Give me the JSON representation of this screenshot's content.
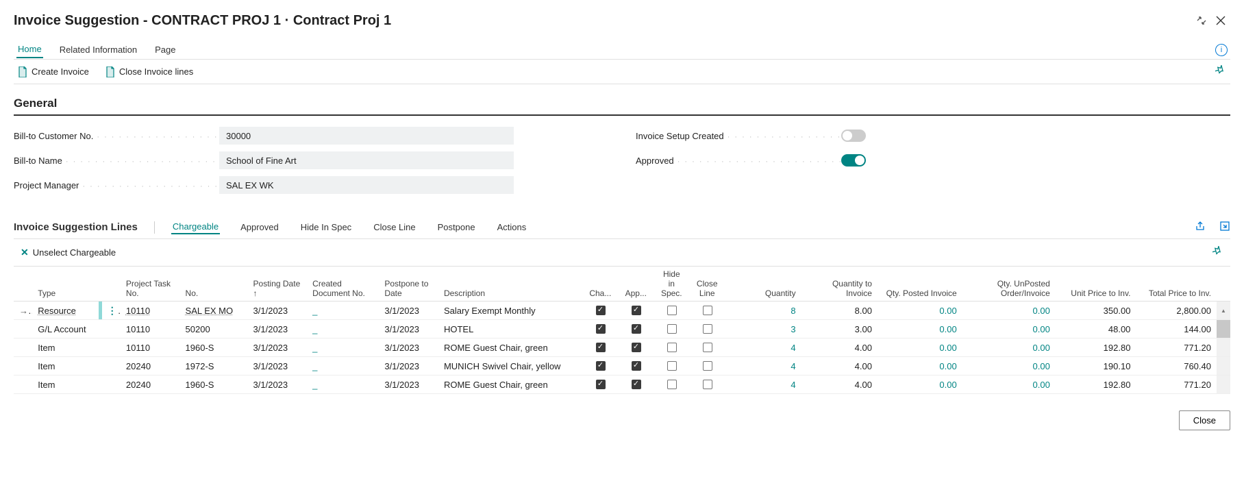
{
  "title": "Invoice Suggestion - CONTRACT PROJ 1 · Contract Proj 1",
  "topTabs": [
    "Home",
    "Related Information",
    "Page"
  ],
  "actions": {
    "createInvoice": "Create Invoice",
    "closeLines": "Close Invoice lines"
  },
  "general": {
    "header": "General",
    "billtoNoLabel": "Bill-to Customer No.",
    "billtoNo": "30000",
    "billtoNameLabel": "Bill-to Name",
    "billtoName": "School of Fine Art",
    "pmLabel": "Project Manager",
    "pm": "SAL EX WK",
    "setupLabel": "Invoice Setup Created",
    "approvedLabel": "Approved"
  },
  "lines": {
    "header": "Invoice Suggestion Lines",
    "tabs": [
      "Chargeable",
      "Approved",
      "Hide In Spec",
      "Close Line",
      "Postpone",
      "Actions"
    ],
    "unselect": "Unselect Chargeable",
    "cols": {
      "type": "Type",
      "taskNo": "Project Task No.",
      "no": "No.",
      "posting": "Posting Date ↑",
      "created": "Created Document No.",
      "postpone": "Postpone to Date",
      "desc": "Description",
      "cha": "Cha...",
      "app": "App...",
      "hide": "Hide in Spec.",
      "close": "Close Line",
      "qty": "Quantity",
      "qtyInv": "Quantity to Invoice",
      "qtyPosted": "Qty. Posted Invoice",
      "qtyUnposted": "Qty. UnPosted Order/Invoice",
      "unitPrice": "Unit Price to Inv.",
      "totalPrice": "Total Price to Inv."
    },
    "rows": [
      {
        "type": "Resource",
        "taskNo": "10110",
        "no": "SAL EX MO",
        "posting": "3/1/2023",
        "created": "_",
        "postpone": "3/1/2023",
        "desc": "Salary Exempt Monthly",
        "cha": true,
        "app": true,
        "hide": false,
        "close": false,
        "qty": "8",
        "qtyInv": "8.00",
        "qtyPosted": "0.00",
        "qtyUnposted": "0.00",
        "unitPrice": "350.00",
        "totalPrice": "2,800.00",
        "sel": true
      },
      {
        "type": "G/L Account",
        "taskNo": "10110",
        "no": "50200",
        "posting": "3/1/2023",
        "created": "_",
        "postpone": "3/1/2023",
        "desc": "HOTEL",
        "cha": true,
        "app": true,
        "hide": false,
        "close": false,
        "qty": "3",
        "qtyInv": "3.00",
        "qtyPosted": "0.00",
        "qtyUnposted": "0.00",
        "unitPrice": "48.00",
        "totalPrice": "144.00"
      },
      {
        "type": "Item",
        "taskNo": "10110",
        "no": "1960-S",
        "posting": "3/1/2023",
        "created": "_",
        "postpone": "3/1/2023",
        "desc": "ROME Guest Chair, green",
        "cha": true,
        "app": true,
        "hide": false,
        "close": false,
        "qty": "4",
        "qtyInv": "4.00",
        "qtyPosted": "0.00",
        "qtyUnposted": "0.00",
        "unitPrice": "192.80",
        "totalPrice": "771.20"
      },
      {
        "type": "Item",
        "taskNo": "20240",
        "no": "1972-S",
        "posting": "3/1/2023",
        "created": "_",
        "postpone": "3/1/2023",
        "desc": "MUNICH Swivel Chair, yellow",
        "cha": true,
        "app": true,
        "hide": false,
        "close": false,
        "qty": "4",
        "qtyInv": "4.00",
        "qtyPosted": "0.00",
        "qtyUnposted": "0.00",
        "unitPrice": "190.10",
        "totalPrice": "760.40"
      },
      {
        "type": "Item",
        "taskNo": "20240",
        "no": "1960-S",
        "posting": "3/1/2023",
        "created": "_",
        "postpone": "3/1/2023",
        "desc": "ROME Guest Chair, green",
        "cha": true,
        "app": true,
        "hide": false,
        "close": false,
        "qty": "4",
        "qtyInv": "4.00",
        "qtyPosted": "0.00",
        "qtyUnposted": "0.00",
        "unitPrice": "192.80",
        "totalPrice": "771.20"
      }
    ]
  },
  "footer": {
    "close": "Close"
  }
}
